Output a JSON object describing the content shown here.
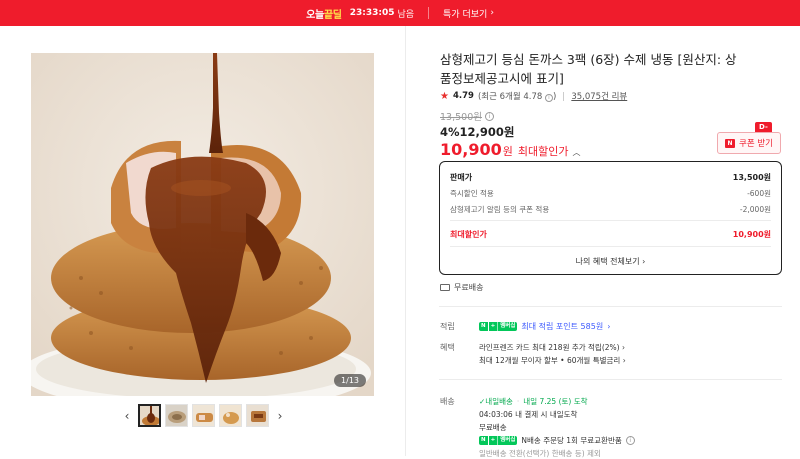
{
  "banner": {
    "deal_prefix": "오늘",
    "deal_suffix": "끝딜",
    "timer": "23:33:05",
    "timer_suffix": "남음",
    "more": "특가 더보기"
  },
  "gallery": {
    "counter": "1/13",
    "thumb_count": 5
  },
  "product": {
    "title": "삼형제고기 등심 돈까스 3팩 (6장) 수제 냉동 [원산지: 상품정보제공고시에 표기]",
    "rating": "4.79",
    "rating_recent": "(최근 6개월 4.78",
    "reviews": "35,075건 리뷰",
    "original_price": "13,500원",
    "sale_percent": "4%",
    "sale_price": "12,900원",
    "final_price": "10,900",
    "final_won": "원",
    "max_discount_label": "최대할인가",
    "coupon_badge": "D-1",
    "coupon_label": "쿠폰 받기"
  },
  "price_box": {
    "rows": [
      {
        "label": "판매가",
        "value": "13,500원"
      },
      {
        "label": "즉시할인 적용",
        "value": "-600원"
      },
      {
        "label": "삼형제고기 알림 등의 쿠폰 적용",
        "value": "-2,000원"
      },
      {
        "label": "최대할인가",
        "value": "10,900원"
      }
    ],
    "link": "나의 혜택 전체보기"
  },
  "shipping_free": "무료배송",
  "points": {
    "label": "적립",
    "badge_plus": "+",
    "badge_member": "멤버십",
    "text": "최대 적립 포인트 585원"
  },
  "benefit": {
    "label": "혜택",
    "line1": "라인프렌즈 카드 최대 218원 추가 적립(2%)",
    "line2": "최대 12개월 무이자 할부 • 60개월 특별금리"
  },
  "delivery": {
    "label": "배송",
    "tomorrow_badge": "내일배송",
    "tomorrow_date": "내일 7.25 (토) 도착",
    "cutoff": "04:03:06  내 결제 시 내일도착",
    "free": "무료배송",
    "return_text": "N배송 주문당 1회 무료교환반품",
    "partial": "일반배송 전환(선택가) 한배송 등) 제외"
  },
  "colors": {
    "accent": "#ef1c2c",
    "npay": "#03c75a",
    "link": "#3d5afe"
  }
}
